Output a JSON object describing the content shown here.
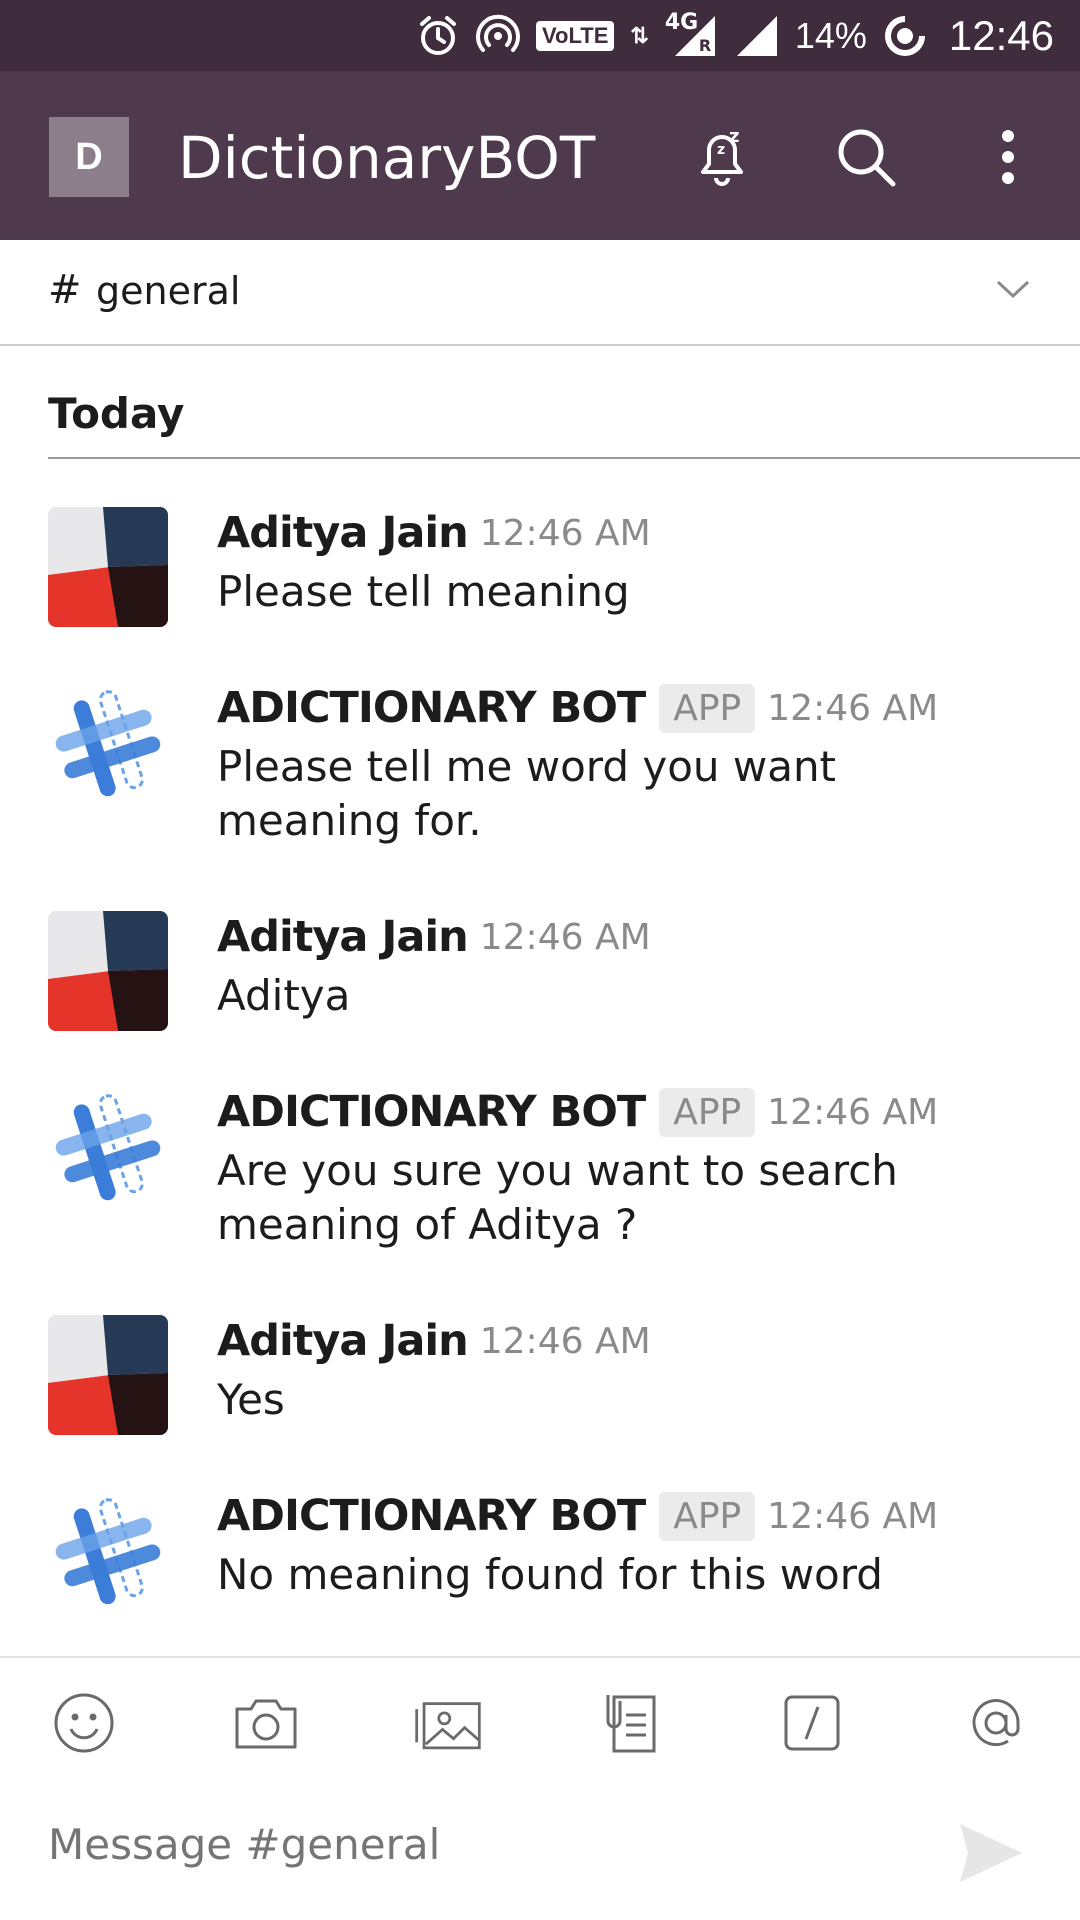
{
  "status_bar": {
    "network": "4G",
    "roaming": "R",
    "volte": "VoLTE",
    "battery": "14%",
    "time": "12:46"
  },
  "header": {
    "team_initial": "D",
    "title": "DictionaryBOT",
    "icons": [
      "snooze-bell-icon",
      "search-icon",
      "more-vert-icon"
    ]
  },
  "channel": {
    "hash": "#",
    "name": "general"
  },
  "day_divider": "Today",
  "messages": [
    {
      "author": "Aditya Jain",
      "app": "",
      "time": "12:46 AM",
      "text": "Please tell meaning"
    },
    {
      "author": "ADICTIONARY BOT",
      "app": "APP",
      "time": "12:46 AM",
      "text": "Please tell me word you want meaning for."
    },
    {
      "author": "Aditya Jain",
      "app": "",
      "time": "12:46 AM",
      "text": "Aditya"
    },
    {
      "author": "ADICTIONARY BOT",
      "app": "APP",
      "time": "12:46 AM",
      "text": "Are you sure you want to search meaning of Aditya ?"
    },
    {
      "author": "Aditya Jain",
      "app": "",
      "time": "12:46 AM",
      "text": "Yes"
    },
    {
      "author": "ADICTIONARY BOT",
      "app": "APP",
      "time": "12:46 AM",
      "text": "No meaning found for this word"
    }
  ],
  "composer": {
    "placeholder": "Message #general",
    "tools": [
      "emoji-icon",
      "camera-icon",
      "gallery-icon",
      "file-icon",
      "slash-command-icon",
      "mention-icon"
    ]
  },
  "colors": {
    "status_bar": "#3f2c3d",
    "app_bar": "#4e3a4c",
    "bot_blue": "#3b7dd8"
  }
}
